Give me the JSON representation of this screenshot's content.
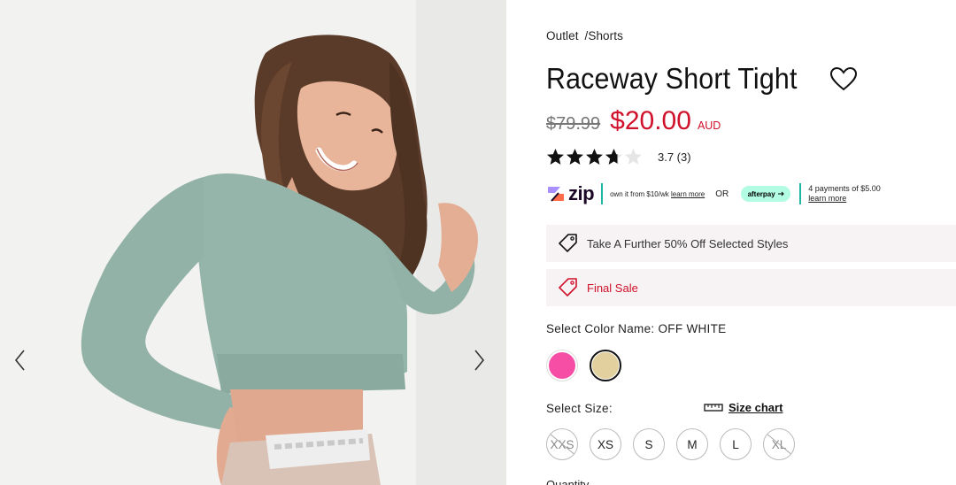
{
  "gallery": {
    "prev_icon": "chevron-left-icon",
    "next_icon": "chevron-right-icon"
  },
  "breadcrumb": {
    "items": [
      "Outlet",
      "/Shorts"
    ]
  },
  "product": {
    "title": "Raceway Short Tight",
    "old_price": "$79.99",
    "price": "$20.00",
    "currency": "AUD",
    "rating": 3.7,
    "rating_text": "3.7  (3)",
    "wishlist_icon": "heart-icon"
  },
  "payments": {
    "zip_logo": "zip",
    "zip_text": "own it from $10/wk",
    "zip_link": "learn more",
    "or": "OR",
    "afterpay_logo": "afterpay",
    "afterpay_text": "4 payments of $5.00",
    "afterpay_link": "learn more"
  },
  "promos": [
    {
      "text": "Take A Further 50% Off Selected Styles",
      "icon": "tag-icon"
    },
    {
      "text": "Final Sale",
      "icon": "tag-icon"
    }
  ],
  "color": {
    "label": "Select Color Name: OFF WHITE",
    "swatches": [
      {
        "name": "pink",
        "hex": "#f74ea5"
      },
      {
        "name": "off-white",
        "hex": "#e2d19e"
      }
    ],
    "selected": 1
  },
  "size": {
    "label": "Select Size:",
    "chart_link": "Size chart",
    "chart_icon": "ruler-icon",
    "options": [
      "XXS",
      "XS",
      "S",
      "M",
      "L",
      "XL"
    ],
    "disabled": [
      "XXS",
      "XL"
    ]
  },
  "quantity": {
    "label": "Quantity"
  },
  "colors": {
    "sale_red": "#d0112b",
    "zip_teal": "#1fb5a8",
    "afterpay_mint": "#b2fce4",
    "promo_bg": "#f7f3f4"
  }
}
